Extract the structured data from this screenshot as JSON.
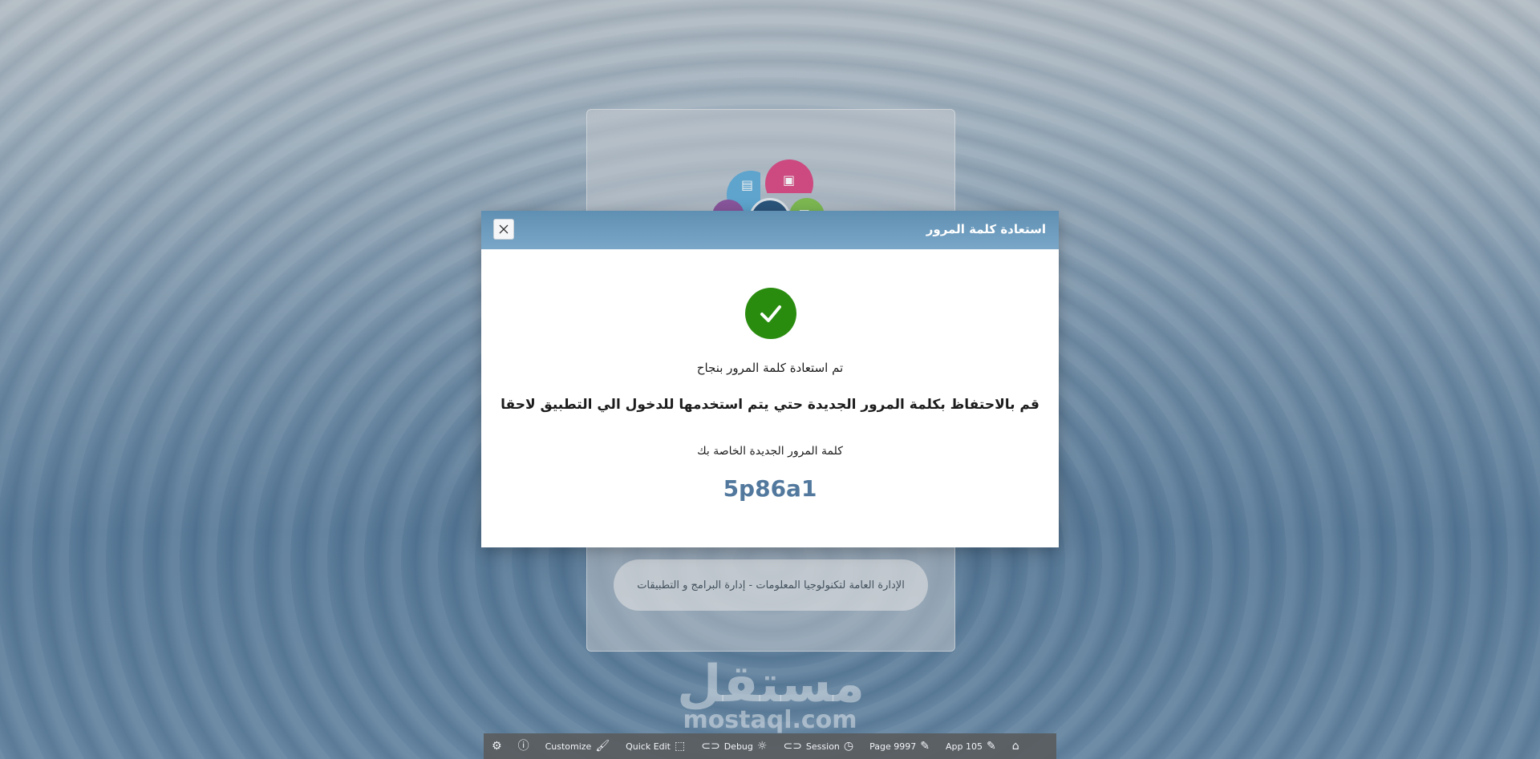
{
  "login_card": {
    "footer_text": "الإدارة العامة لتكنولوجيا المعلومات - إدارة البرامج و التطبيقات"
  },
  "dialog": {
    "title": "استعادة كلمة المرور",
    "close_icon": "close-icon",
    "success_icon": "check-icon",
    "success_color": "#2a8c0f",
    "message_success": "تم استعادة كلمة المرور بنجاح",
    "message_keep": "قم بالاحتفاظ بكلمة المرور الجديدة حتي يتم استخدمها للدخول الي التطبيق لاحقا",
    "new_password_label": "كلمة المرور الجديدة الخاصة بك",
    "new_password_value": "5p86a1"
  },
  "watermark": {
    "arabic": "مستقل",
    "latin": "mostaql.com"
  },
  "devbar": {
    "items": [
      {
        "icon": "gear-icon"
      },
      {
        "icon": "info-icon"
      },
      {
        "label": "Customize",
        "icon": "brush-icon"
      },
      {
        "label": "Quick Edit",
        "icon": "cursor-edit-icon"
      },
      {
        "label": "Debug",
        "icon": "bug-icon"
      },
      {
        "label": "Session",
        "icon": "clock-icon"
      },
      {
        "label": "Page 9997",
        "icon": "page-edit-icon"
      },
      {
        "label": "App 105",
        "icon": "edit-icon"
      },
      {
        "icon": "home-icon"
      }
    ]
  }
}
